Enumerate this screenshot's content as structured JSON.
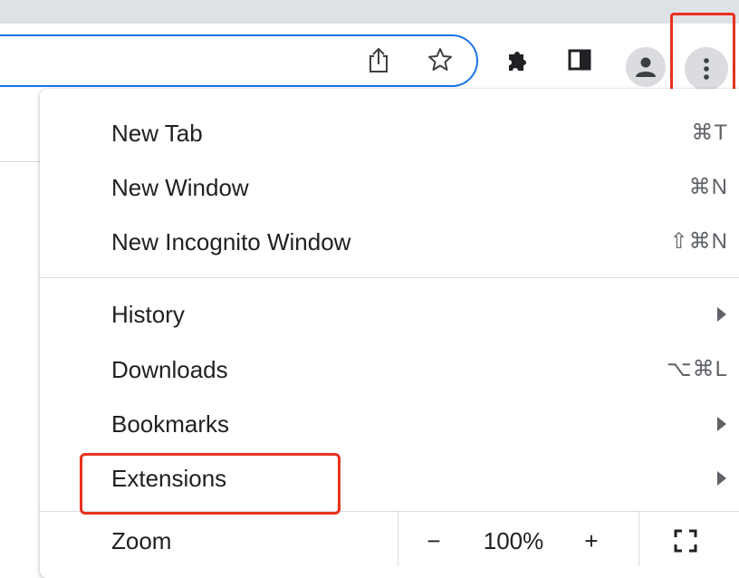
{
  "toolbar": {
    "icons": [
      "share-icon",
      "bookmark-star-icon",
      "extensions-puzzle-icon",
      "side-panel-icon",
      "profile-icon",
      "more-menu-icon"
    ]
  },
  "menu": {
    "new_tab": {
      "label": "New Tab",
      "shortcut": "⌘T"
    },
    "new_window": {
      "label": "New Window",
      "shortcut": "⌘N"
    },
    "new_incognito": {
      "label": "New Incognito Window",
      "shortcut": "⇧⌘N"
    },
    "history": {
      "label": "History"
    },
    "downloads": {
      "label": "Downloads",
      "shortcut": "⌥⌘L"
    },
    "bookmarks": {
      "label": "Bookmarks"
    },
    "extensions": {
      "label": "Extensions"
    },
    "zoom": {
      "label": "Zoom",
      "minus": "−",
      "value": "100%",
      "plus": "+"
    }
  },
  "colors": {
    "highlight": "#e8321e",
    "omnibox_border": "#1a73e8",
    "tabstrip": "#dee1e6"
  }
}
